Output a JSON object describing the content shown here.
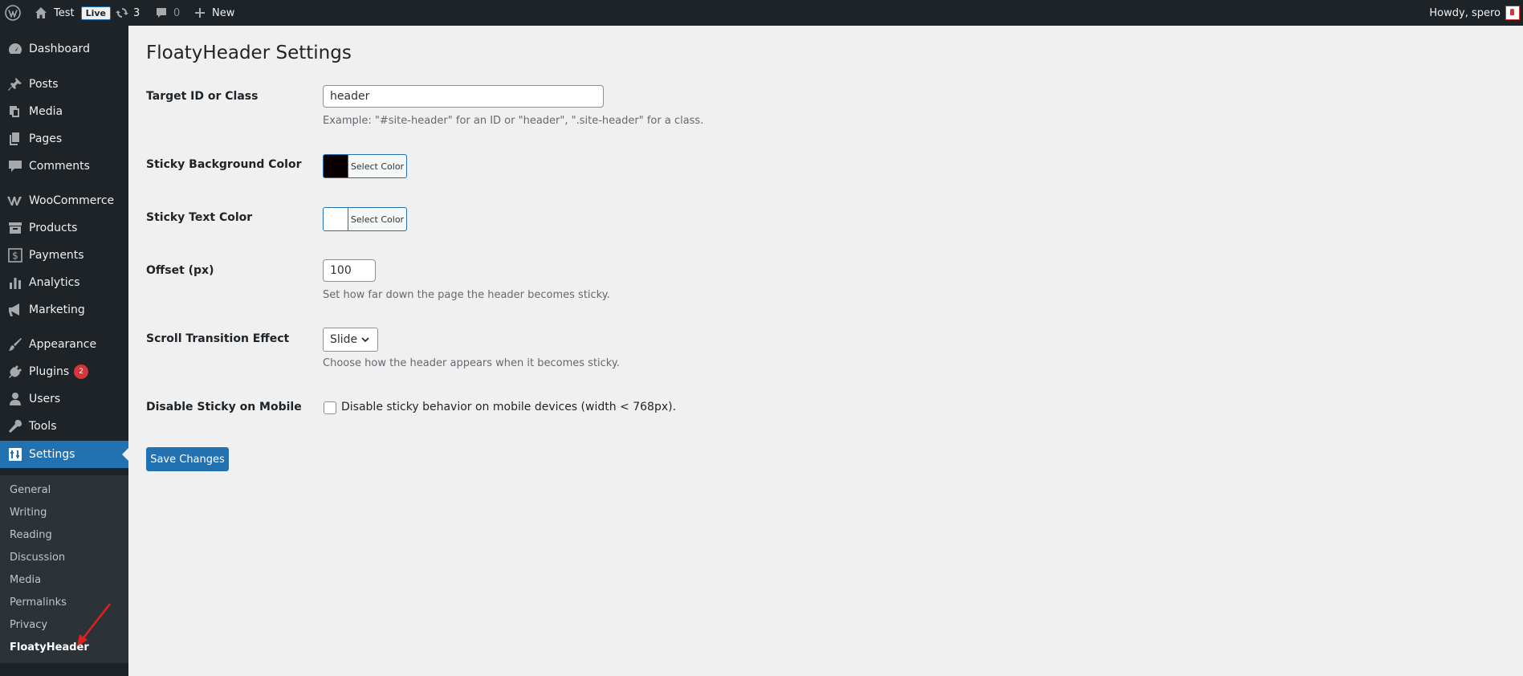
{
  "adminbar": {
    "site_name": "Test",
    "live_label": "Live",
    "updates_count": "3",
    "comments_count": "0",
    "new_label": "New",
    "howdy": "Howdy, spero"
  },
  "sidebar": {
    "items": [
      {
        "label": "Dashboard",
        "icon": "dashboard-icon"
      },
      {
        "label": "Posts",
        "icon": "pin-icon"
      },
      {
        "label": "Media",
        "icon": "media-icon"
      },
      {
        "label": "Pages",
        "icon": "pages-icon"
      },
      {
        "label": "Comments",
        "icon": "comment-icon"
      },
      {
        "label": "WooCommerce",
        "icon": "woocommerce-icon"
      },
      {
        "label": "Products",
        "icon": "archive-icon"
      },
      {
        "label": "Payments",
        "icon": "dollar-icon"
      },
      {
        "label": "Analytics",
        "icon": "bar-chart-icon"
      },
      {
        "label": "Marketing",
        "icon": "megaphone-icon"
      },
      {
        "label": "Appearance",
        "icon": "brush-icon"
      },
      {
        "label": "Plugins",
        "icon": "plug-icon",
        "badge": "2"
      },
      {
        "label": "Users",
        "icon": "user-icon"
      },
      {
        "label": "Tools",
        "icon": "wrench-icon"
      },
      {
        "label": "Settings",
        "icon": "settings-icon",
        "active": true
      }
    ],
    "submenu": [
      "General",
      "Writing",
      "Reading",
      "Discussion",
      "Media",
      "Permalinks",
      "Privacy",
      "FloatyHeader"
    ],
    "submenu_current": "FloatyHeader"
  },
  "main": {
    "title": "FloatyHeader Settings",
    "fields": {
      "target": {
        "label": "Target ID or Class",
        "value": "header",
        "description": "Example: \"#site-header\" for an ID or \"header\", \".site-header\" for a class."
      },
      "bg_color": {
        "label": "Sticky Background Color",
        "button_label": "Select Color",
        "swatch_color": "#0a0000"
      },
      "text_color": {
        "label": "Sticky Text Color",
        "button_label": "Select Color",
        "swatch_color": "#ffffff"
      },
      "offset": {
        "label": "Offset (px)",
        "value": "100",
        "description": "Set how far down the page the header becomes sticky."
      },
      "transition": {
        "label": "Scroll Transition Effect",
        "selected": "Slide",
        "description": "Choose how the header appears when it becomes sticky."
      },
      "mobile": {
        "label": "Disable Sticky on Mobile",
        "checkbox_label": "Disable sticky behavior on mobile devices (width < 768px).",
        "checked": false
      }
    },
    "save_label": "Save Changes"
  },
  "colors": {
    "adminbar_bg": "#1d2327",
    "sidebar_bg": "#1d2327",
    "submenu_bg": "#2c3338",
    "accent": "#2271b1",
    "badge": "#d63638",
    "page_bg": "#f0f0f1"
  }
}
